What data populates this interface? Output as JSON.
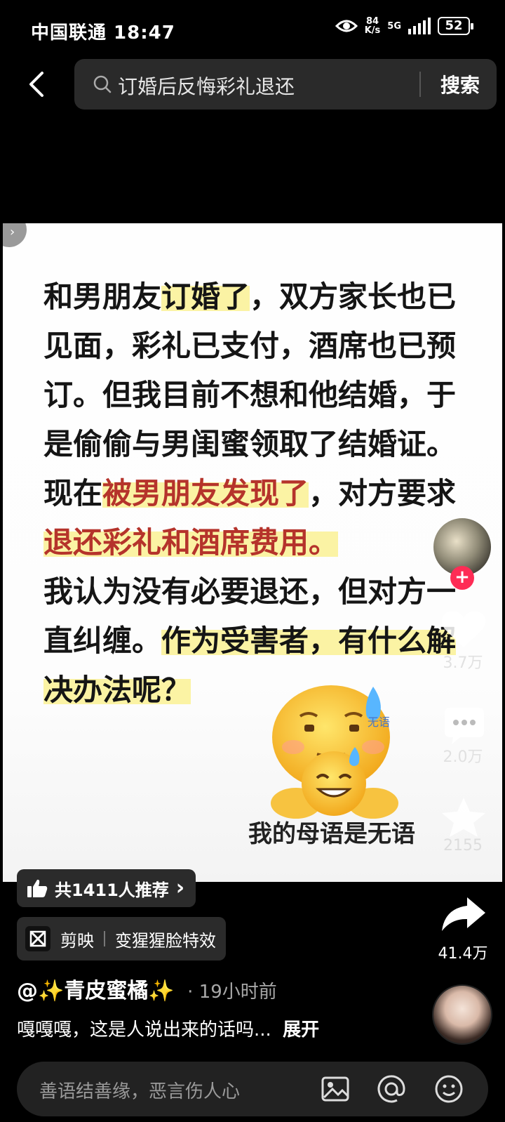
{
  "status_bar": {
    "carrier_time": "中国联通 18:47",
    "speed_value": "84",
    "speed_unit": "K/s",
    "network": "5G",
    "battery": "52"
  },
  "search": {
    "query": "订婚后反悔彩礼退还",
    "button_label": "搜索"
  },
  "post": {
    "lines": [
      [
        {
          "t": "和男朋友",
          "s": ""
        },
        {
          "t": "订婚了",
          "s": "y"
        },
        {
          "t": "，双方家长也已",
          "s": ""
        }
      ],
      [
        {
          "t": "见面，彩礼已支付，酒席也已预",
          "s": ""
        }
      ],
      [
        {
          "t": "订。但我目前不想和他结婚，于",
          "s": ""
        }
      ],
      [
        {
          "t": "是偷偷与男闺蜜领取了结婚证。",
          "s": ""
        }
      ],
      [
        {
          "t": "现在",
          "s": ""
        },
        {
          "t": "被男朋友发现了",
          "s": "r"
        },
        {
          "t": "，对方要求",
          "s": ""
        }
      ],
      [
        {
          "t": "退还彩礼和酒席费用。",
          "s": "r"
        }
      ],
      [
        {
          "t": "我认为没有必要退还，但对方一",
          "s": ""
        }
      ],
      [
        {
          "t": "直纠缠。",
          "s": ""
        },
        {
          "t": "作为受害者，有什么解",
          "s": "y"
        }
      ],
      [
        {
          "t": "决办法呢？",
          "s": "y"
        }
      ]
    ],
    "emoji_label": "无语",
    "caption": "我的母语是无语"
  },
  "actions": {
    "like_count": "3.7万",
    "like_icon_text": "解",
    "comment_count": "2.0万",
    "favorite_count": "2155",
    "share_count": "41.4万",
    "follow_symbol": "+"
  },
  "recommend": {
    "label": "共1411人推荐",
    "chevron": "›"
  },
  "jianying": {
    "app": "剪映",
    "effect": "变猩猩脸特效"
  },
  "author": {
    "name": "@✨青皮蜜橘✨",
    "time": "· 19小时前"
  },
  "description": {
    "text": "嘎嘎嘎，这是人说出来的话吗...",
    "expand": "展开"
  },
  "comment_bar": {
    "placeholder": "善语结善缘，恶言伤人心"
  },
  "colors": {
    "accent": "#fe2c55",
    "highlight": "#fbf3a4",
    "red_text": "#b5332b"
  }
}
